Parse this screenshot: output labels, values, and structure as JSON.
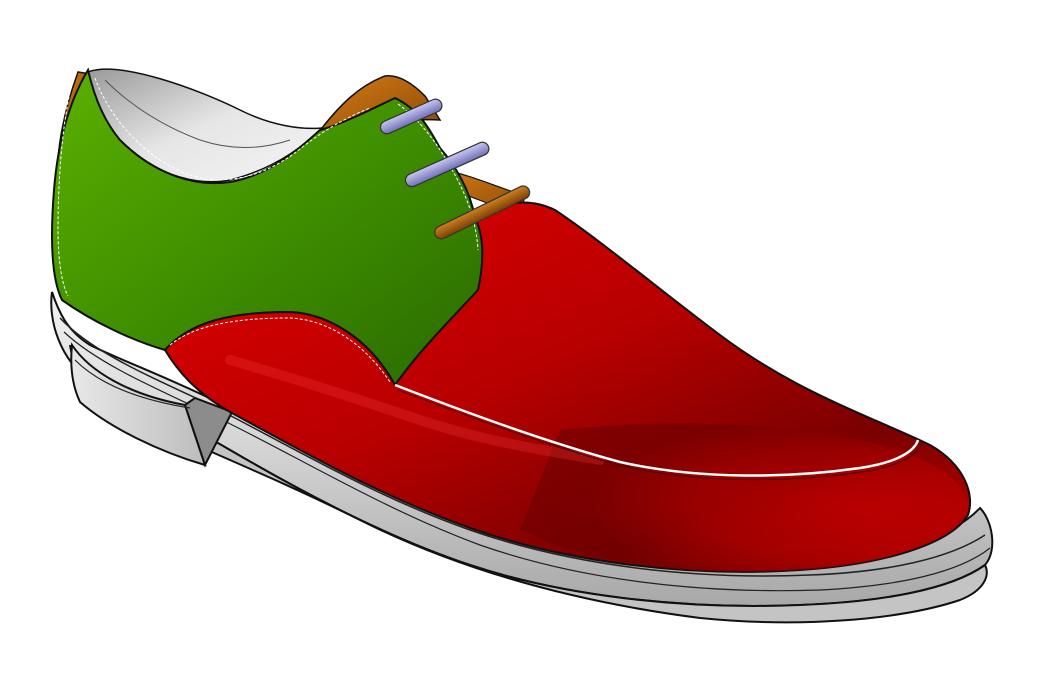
{
  "scene": {
    "subject_icon": "shoe-render",
    "colors": {
      "background": "#ffffff",
      "vamp": "#c80000",
      "quarter": "#4a9a00",
      "heel_counter": "#c06a10",
      "tongue": "#c06a10",
      "sole": "#d6d6d6",
      "lining": "#e2e2e2",
      "lace_upper": "#9a9ad8",
      "lace_lower": "#b46a14",
      "stitching": "#ffffff"
    }
  }
}
